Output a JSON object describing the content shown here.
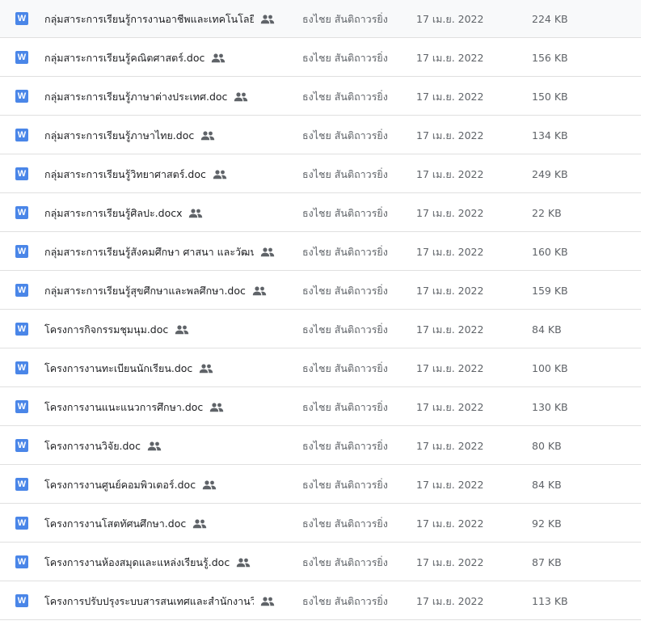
{
  "file_type_glyph": "W",
  "colors": {
    "word_icon": "#4a86e8",
    "shared_icon": "#5f6368"
  },
  "files": [
    {
      "name": "กลุ่มสาระการเรียนรู้การงานอาชีพและเทคโนโลยี.d...",
      "owner": "ธงไชย สันติถาวรยิ่ง",
      "modified": "17 เม.ย. 2022",
      "size": "224 KB",
      "shared": true
    },
    {
      "name": "กลุ่มสาระการเรียนรู้คณิตศาสตร์.doc",
      "owner": "ธงไชย สันติถาวรยิ่ง",
      "modified": "17 เม.ย. 2022",
      "size": "156 KB",
      "shared": true
    },
    {
      "name": "กลุ่มสาระการเรียนรู้ภาษาต่างประเทศ.doc",
      "owner": "ธงไชย สันติถาวรยิ่ง",
      "modified": "17 เม.ย. 2022",
      "size": "150 KB",
      "shared": true
    },
    {
      "name": "กลุ่มสาระการเรียนรู้ภาษาไทย.doc",
      "owner": "ธงไชย สันติถาวรยิ่ง",
      "modified": "17 เม.ย. 2022",
      "size": "134 KB",
      "shared": true
    },
    {
      "name": "กลุ่มสาระการเรียนรู้วิทยาศาสตร์.doc",
      "owner": "ธงไชย สันติถาวรยิ่ง",
      "modified": "17 เม.ย. 2022",
      "size": "249 KB",
      "shared": true
    },
    {
      "name": "กลุ่มสาระการเรียนรู้ศิลปะ.docx",
      "owner": "ธงไชย สันติถาวรยิ่ง",
      "modified": "17 เม.ย. 2022",
      "size": "22 KB",
      "shared": true
    },
    {
      "name": "กลุ่มสาระการเรียนรู้สังคมศึกษา ศาสนา และวัฒนธร...",
      "owner": "ธงไชย สันติถาวรยิ่ง",
      "modified": "17 เม.ย. 2022",
      "size": "160 KB",
      "shared": true
    },
    {
      "name": "กลุ่มสาระการเรียนรู้สุขศึกษาและพลศึกษา.doc",
      "owner": "ธงไชย สันติถาวรยิ่ง",
      "modified": "17 เม.ย. 2022",
      "size": "159 KB",
      "shared": true
    },
    {
      "name": "โครงการกิจกรรมชุมนุม.doc",
      "owner": "ธงไชย สันติถาวรยิ่ง",
      "modified": "17 เม.ย. 2022",
      "size": "84 KB",
      "shared": true
    },
    {
      "name": "โครงการงานทะเบียนนักเรียน.doc",
      "owner": "ธงไชย สันติถาวรยิ่ง",
      "modified": "17 เม.ย. 2022",
      "size": "100 KB",
      "shared": true
    },
    {
      "name": "โครงการงานแนะแนวการศึกษา.doc",
      "owner": "ธงไชย สันติถาวรยิ่ง",
      "modified": "17 เม.ย. 2022",
      "size": "130 KB",
      "shared": true
    },
    {
      "name": "โครงการงานวิจัย.doc",
      "owner": "ธงไชย สันติถาวรยิ่ง",
      "modified": "17 เม.ย. 2022",
      "size": "80 KB",
      "shared": true
    },
    {
      "name": "โครงการงานศูนย์คอมพิวเตอร์.doc",
      "owner": "ธงไชย สันติถาวรยิ่ง",
      "modified": "17 เม.ย. 2022",
      "size": "84 KB",
      "shared": true
    },
    {
      "name": "โครงการงานโสตทัศนศึกษา.doc",
      "owner": "ธงไชย สันติถาวรยิ่ง",
      "modified": "17 เม.ย. 2022",
      "size": "92 KB",
      "shared": true
    },
    {
      "name": "โครงการงานห้องสมุดและแหล่งเรียนรู้.doc",
      "owner": "ธงไชย สันติถาวรยิ่ง",
      "modified": "17 เม.ย. 2022",
      "size": "87 KB",
      "shared": true
    },
    {
      "name": "โครงการปรับปรุงระบบสารสนเทศและสำนักงานวิช...",
      "owner": "ธงไชย สันติถาวรยิ่ง",
      "modified": "17 เม.ย. 2022",
      "size": "113 KB",
      "shared": true
    }
  ]
}
